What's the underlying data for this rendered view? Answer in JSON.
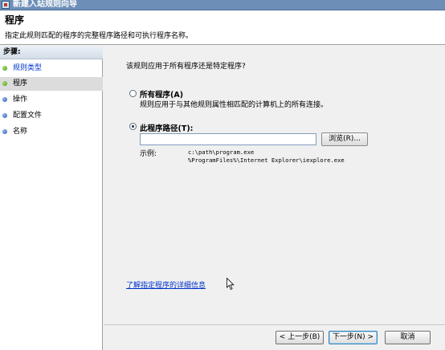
{
  "window": {
    "title": "新建入站规则向导"
  },
  "header": {
    "title": "程序",
    "description": "指定此规则匹配的程序的完整程序路径和可执行程序名称。"
  },
  "sidebar": {
    "steps_label": "步骤:",
    "items": [
      {
        "label": "规则类型",
        "state": "done"
      },
      {
        "label": "程序",
        "state": "current"
      },
      {
        "label": "操作",
        "state": "pending"
      },
      {
        "label": "配置文件",
        "state": "pending"
      },
      {
        "label": "名称",
        "state": "pending"
      }
    ]
  },
  "main": {
    "question": "该规则应用于所有程序还是特定程序?",
    "all_programs": {
      "label": "所有程序(A)",
      "description": "规则应用于与其他规则属性相匹配的计算机上的所有连接。",
      "selected": false
    },
    "program_path": {
      "label": "此程序路径(T):",
      "value": "",
      "selected": true
    },
    "browse_label": "浏览(R)...",
    "example_label": "示例:",
    "example_lines": [
      "c:\\path\\program.exe",
      "%ProgramFiles%\\Internet Explorer\\iexplore.exe"
    ],
    "help_link": "了解指定程序的详细信息"
  },
  "footer": {
    "back_label": "< 上一步(B)",
    "next_label": "下一步(N) >",
    "cancel_label": "取消"
  }
}
